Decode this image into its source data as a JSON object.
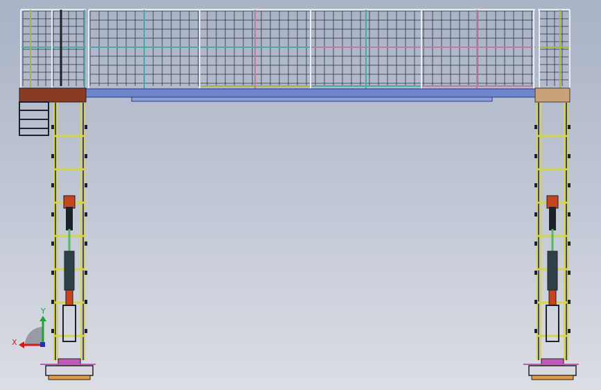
{
  "colors": {
    "bg_top": "#a9b3c6",
    "bg_bottom": "#dcdee4",
    "mesh": "#2b2f3a",
    "rail_white": "#e6ecf2",
    "rail_teal": "#49a8a8",
    "rail_olive": "#a8b44a",
    "rail_pink": "#c07aa0",
    "deck": "#6f85c9",
    "deck_edge": "#2a3a8a",
    "column_rail": "#d8d448",
    "column_frame": "#1d2128",
    "cylinder": "#2e4148",
    "rod": "#58b860",
    "clevis_red": "#c8431f",
    "end_block_left": "#8a3b24",
    "end_block_right": "#c9a27a",
    "base_magenta": "#c05ab8",
    "base_orange": "#e39a3c",
    "axis_x": "#d31b1b",
    "axis_y": "#1aa53a",
    "axis_z": "#1f2fb8"
  },
  "triad": {
    "x_label": "X",
    "y_label": "Y"
  }
}
